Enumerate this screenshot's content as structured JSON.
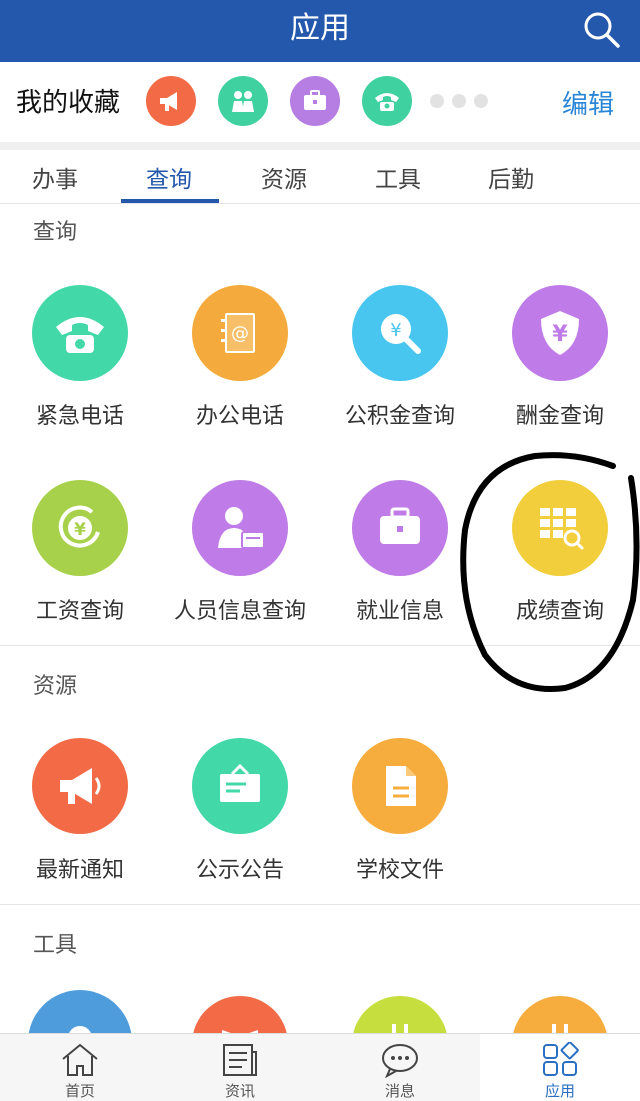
{
  "header": {
    "title": "应用",
    "search_icon": "search-icon"
  },
  "favorites": {
    "title": "我的收藏",
    "edit_label": "编辑",
    "items": [
      {
        "icon": "megaphone-icon",
        "color": "#f26b46"
      },
      {
        "icon": "people-icon",
        "color": "#3fd2a0"
      },
      {
        "icon": "briefcase-icon",
        "color": "#b67ee3"
      },
      {
        "icon": "phone-icon",
        "color": "#3fd2a0"
      }
    ]
  },
  "tabs": [
    {
      "label": "办事",
      "active": false
    },
    {
      "label": "查询",
      "active": true
    },
    {
      "label": "资源",
      "active": false
    },
    {
      "label": "工具",
      "active": false
    },
    {
      "label": "后勤",
      "active": false
    }
  ],
  "sections": {
    "query": {
      "title": "查询",
      "items": [
        {
          "label": "紧急电话",
          "icon": "phone-icon",
          "color": "#43d8a8"
        },
        {
          "label": "办公电话",
          "icon": "address-book-icon",
          "color": "#f4aa3c"
        },
        {
          "label": "公积金查询",
          "icon": "search-yen-icon",
          "color": "#48c6f0"
        },
        {
          "label": "酬金查询",
          "icon": "shield-yen-icon",
          "color": "#bf7be8"
        },
        {
          "label": "工资查询",
          "icon": "yen-coin-icon",
          "color": "#a8d14b"
        },
        {
          "label": "人员信息查询",
          "icon": "person-info-icon",
          "color": "#bf7be8"
        },
        {
          "label": "就业信息",
          "icon": "briefcase-icon",
          "color": "#bf7be8"
        },
        {
          "label": "成绩查询",
          "icon": "grid-search-icon",
          "color": "#f2cd3c"
        }
      ]
    },
    "resources": {
      "title": "资源",
      "items": [
        {
          "label": "最新通知",
          "icon": "megaphone-icon",
          "color": "#f26b46"
        },
        {
          "label": "公示公告",
          "icon": "notice-board-icon",
          "color": "#43d8a8"
        },
        {
          "label": "学校文件",
          "icon": "document-icon",
          "color": "#f7ad3e"
        }
      ]
    },
    "tools": {
      "title": "工具",
      "items": [
        {
          "icon": "location-icon",
          "color": "#4e9cdc"
        },
        {
          "icon": "book-icon",
          "color": "#f26b46"
        },
        {
          "icon": "calendar-icon",
          "color": "#c6df3e"
        },
        {
          "icon": "calendar-icon",
          "color": "#f7ad3e"
        }
      ]
    }
  },
  "bottom_nav": [
    {
      "label": "首页",
      "icon": "home-icon",
      "active": false
    },
    {
      "label": "资讯",
      "icon": "news-icon",
      "active": false
    },
    {
      "label": "消息",
      "icon": "chat-icon",
      "active": false
    },
    {
      "label": "应用",
      "icon": "apps-icon",
      "active": true
    }
  ],
  "colors": {
    "primary": "#2458ad",
    "accent": "#2a86d6",
    "annotation": "#000000"
  }
}
